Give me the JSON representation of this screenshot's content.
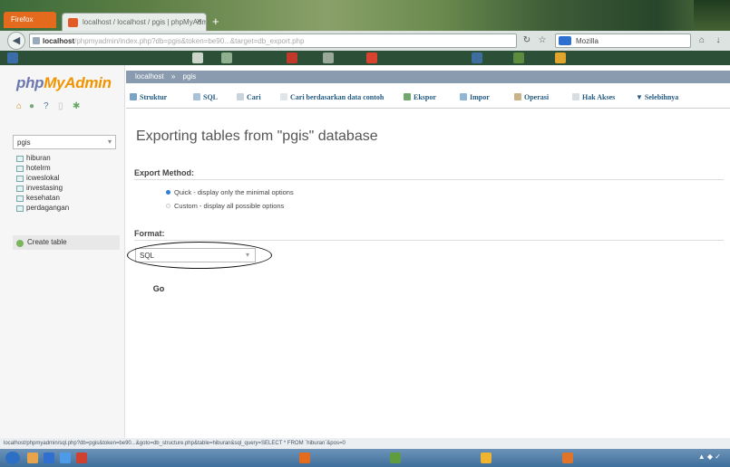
{
  "browser": {
    "app_button": "Firefox",
    "tab_title": "localhost / localhost / pgis | phpMyAdmin",
    "tab_close": "×",
    "new_tab": "+",
    "url_host": "localhost",
    "url_rest": "/phpmyadmin/index.php?db=pgis&token=be90...&target=db_export.php",
    "search_engine": "Bing",
    "search_value": "Mozilla"
  },
  "sidebar": {
    "logo_php": "php",
    "logo_myadmin": "MyAdmin",
    "db_selected": "pgis",
    "tables": [
      "hiburan",
      "hotelrm",
      "icweslokal",
      "investasing",
      "kesehatan",
      "perdagangan"
    ],
    "create_table": "Create table"
  },
  "breadcrumb": {
    "server": "localhost",
    "db": "pgis"
  },
  "tabs": {
    "struktur": "Struktur",
    "sql": "SQL",
    "cari": "Cari",
    "cari_contoh": "Cari berdasarkan data contoh",
    "ekspor": "Ekspor",
    "impor": "Impor",
    "operasi": "Operasi",
    "hak_akses": "Hak Akses",
    "selebihnya": "Selebihnya"
  },
  "main": {
    "heading": "Exporting tables from \"pgis\" database",
    "export_method_label": "Export Method:",
    "quick_option": "Quick - display only the minimal options",
    "custom_option": "Custom - display all possible options",
    "format_label": "Format:",
    "format_value": "SQL",
    "go_label": "Go"
  },
  "status": {
    "url": "localhost/phpmyadmin/sql.php?db=pgis&token=be90...&goto=db_structure.php&table=hiburan&sql_query=SELECT * FROM `hiburan`&pos=0"
  },
  "colors": {
    "logo_php": "#6c78af",
    "logo_myadmin": "#f29400",
    "tab_link": "#235a81",
    "radio_selected": "#2f7fd6"
  }
}
